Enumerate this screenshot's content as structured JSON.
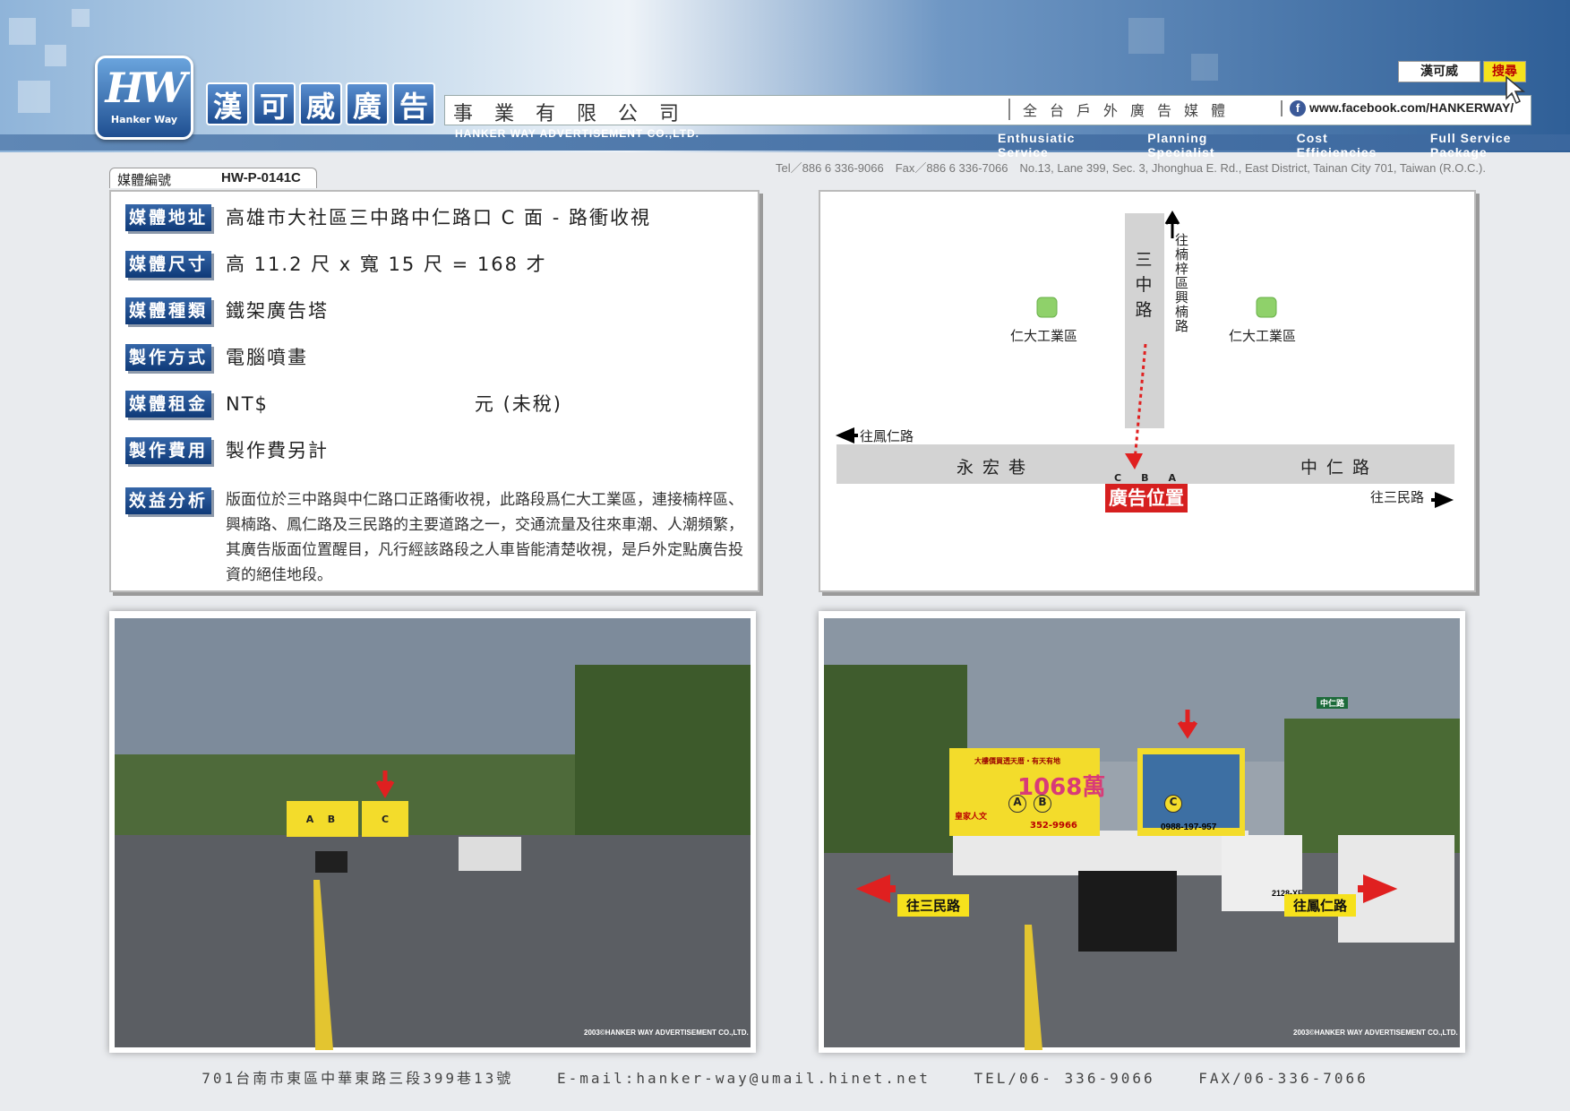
{
  "header": {
    "logo_text": "HW",
    "logo_sub": "Hanker Way",
    "brand_chars": [
      "漢",
      "可",
      "威",
      "廣",
      "告"
    ],
    "company_cn": "事業有限公司",
    "company_en": "HANKER WAY ADVERTISEMENT CO.,LTD.",
    "slogan": "全台戶外廣告媒體",
    "facebook_url": "www.facebook.com/HANKERWAY/",
    "search_value": "漢可威",
    "search_button": "搜尋",
    "taglines": [
      "Enthusiatic Service",
      "Planning Specialist",
      "Cost Efficiencies",
      "Full Service Package"
    ],
    "contact_line": "Tel／886 6 336-9066　Fax／886 6 336-7066　No.13, Lane 399, Sec. 3, Jhonghua E. Rd., East District, Tainan City 701, Taiwan (R.O.C.)."
  },
  "media": {
    "id_label": "媒體編號",
    "id_value": "HW-P-0141C"
  },
  "info": [
    {
      "label": "媒體地址",
      "value": "高雄市大社區三中路中仁路口 C 面 - 路衝收視"
    },
    {
      "label": "媒體尺寸",
      "value": "高 11.2 尺 x 寬 15 尺 = 168 才"
    },
    {
      "label": "媒體種類",
      "value": "鐵架廣告塔"
    },
    {
      "label": "製作方式",
      "value": "電腦噴畫"
    },
    {
      "label": "媒體租金",
      "value": "NT$　　　　　　　　　　元 (未稅)"
    },
    {
      "label": "製作費用",
      "value": "製作費另計"
    },
    {
      "label": "效益分析",
      "value": "版面位於三中路與中仁路口正路衝收視，此路段爲仁大工業區，連接楠梓區、興楠路、鳳仁路及三民路的主要道路之一，交通流量及往來車潮、人潮頻繁，其廣告版面位置醒目，凡行經該路段之人車皆能清楚收視，是戶外定點廣告投資的絕佳地段。"
    }
  ],
  "map": {
    "road_vertical": "三中路",
    "north_label": "往楠梓區興楠路",
    "west_label": "往鳳仁路",
    "east_label": "往三民路",
    "road_left": "永宏巷",
    "road_right": "中仁路",
    "park_left": "仁大工業區",
    "park_right": "仁大工業區",
    "faces": [
      "C",
      "B",
      "A"
    ],
    "ad_position": "廣告位置"
  },
  "photos": {
    "left": {
      "markers": [
        "A",
        "B",
        "C"
      ],
      "credit": "2003©HANKER WAY ADVERTISEMENT CO.,LTD."
    },
    "right": {
      "markers": [
        "A",
        "B",
        "C"
      ],
      "arrow_left": "往三民路",
      "arrow_right": "往鳳仁路",
      "sign_a_text": "大樓價買透天厝・有天有地",
      "sign_a_price": "1068萬",
      "sign_a_brand": "皇家人文",
      "sign_a_phone": "352-9966",
      "sign_c_phone": "0988-197-957",
      "street_sign": "中仁路",
      "car_plate": "2128-XE",
      "credit": "2003©HANKER WAY ADVERTISEMENT CO.,LTD."
    }
  },
  "footer": {
    "address": "701台南市東區中華東路三段399巷13號",
    "email": "E-mail:hanker-way@umail.hinet.net",
    "tel": "TEL/06- 336-9066",
    "fax": "FAX/06-336-7066"
  }
}
